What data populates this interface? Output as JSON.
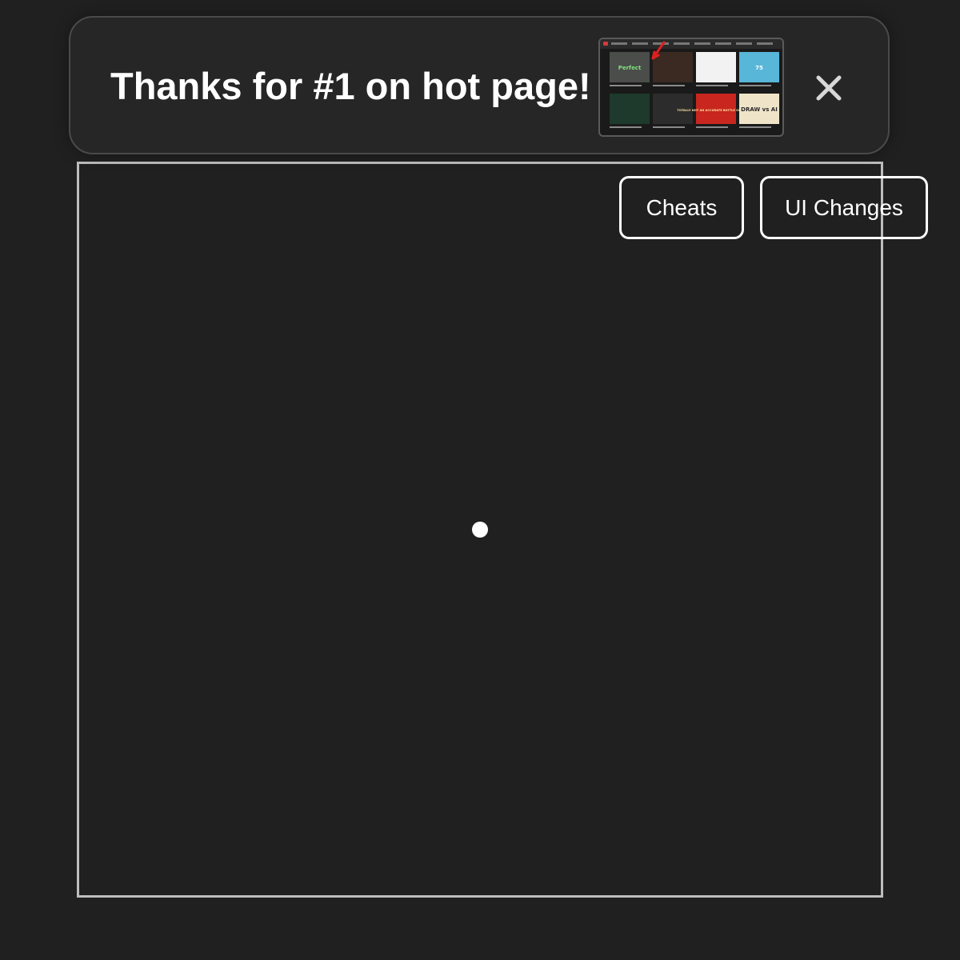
{
  "banner": {
    "message": "Thanks for #1 on hot page!",
    "thumbnail_icon": "hot-page-screenshot-thumbnail",
    "thumbnail_tiles": [
      {
        "label": "Perfect",
        "bg": "#4a4d4a",
        "fg": "#7ee07e"
      },
      {
        "label": "",
        "bg": "#3a2a22",
        "fg": "#a06a4a"
      },
      {
        "label": "",
        "bg": "#f2f2f2",
        "fg": "#333333"
      },
      {
        "label": "75",
        "bg": "#58b6d8",
        "fg": "#ffffff"
      },
      {
        "label": "",
        "bg": "#1e3a2c",
        "fg": "#e8c040"
      },
      {
        "label": "",
        "bg": "#2c2c2c",
        "fg": "#b89a86"
      },
      {
        "label": "TOTALLY NOT AN ACCURATE BATTLE SIMULATOR",
        "bg": "#c8261e",
        "fg": "#ffe0a0"
      },
      {
        "label": "DRAW vs AI",
        "bg": "#efe4c8",
        "fg": "#2a2a2a"
      }
    ],
    "close_icon": "close-icon"
  },
  "toolbar": {
    "cheats_label": "Cheats",
    "ui_changes_label": "UI Changes"
  },
  "colors": {
    "background": "#202020",
    "frame_border": "#bdbdbd",
    "text": "#ffffff"
  }
}
